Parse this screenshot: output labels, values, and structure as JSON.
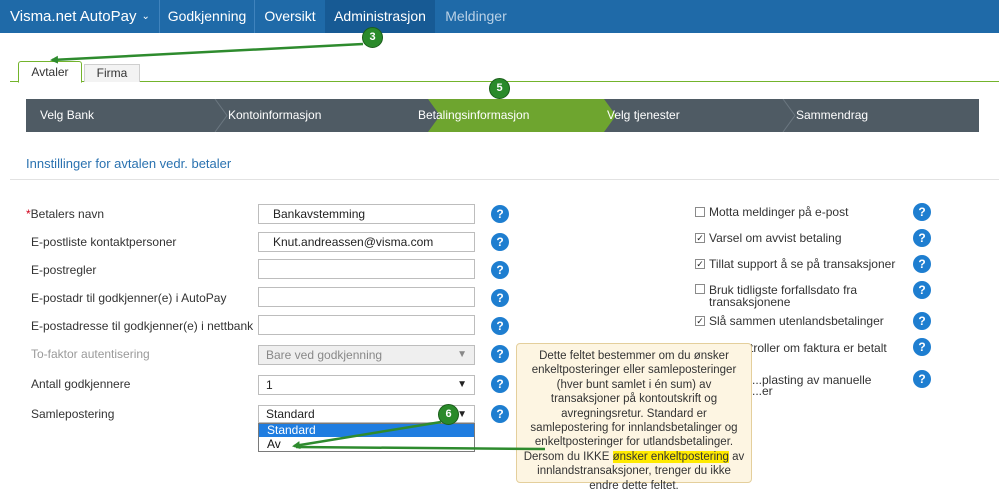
{
  "nav": {
    "brand": "Visma.net AutoPay",
    "items": [
      "Godkjenning",
      "Oversikt",
      "Administrasjon",
      "Meldinger"
    ],
    "active": "Administrasjon"
  },
  "tabs": [
    "Avtaler",
    "Firma"
  ],
  "wizard": {
    "steps": [
      "Velg Bank",
      "Kontoinformasjon",
      "Betalingsinformasjon",
      "Velg tjenester",
      "Sammendrag"
    ],
    "current": "Betalingsinformasjon"
  },
  "section_title": "Innstillinger for avtalen vedr. betaler",
  "form": {
    "betalers_navn_label": "Betalers navn",
    "betalers_navn_required": "*",
    "betalers_navn_value": "Bankavstemming",
    "kontaktpersoner_label": "E-postliste kontaktpersoner",
    "kontaktpersoner_value": "Knut.andreassen@visma.com",
    "epostregler_label": "E-postregler",
    "epostregler_value": "",
    "godkjenner_autopay_label": "E-postadr til godkjenner(e) i AutoPay",
    "godkjenner_autopay_value": "",
    "godkjenner_nettbank_label": "E-postadresse til godkjenner(e) i nettbank",
    "godkjenner_nettbank_value": "",
    "tofaktor_label": "To-faktor autentisering",
    "tofaktor_value": "Bare ved godkjenning",
    "antall_label": "Antall godkjennere",
    "antall_value": "1",
    "samlepostering_label": "Samlepostering",
    "samlepostering_value": "Standard",
    "samlepostering_options": [
      "Standard",
      "Av"
    ]
  },
  "checkboxes": [
    {
      "label": "Motta meldinger på e-post",
      "checked": false
    },
    {
      "label": "Varsel om avvist betaling",
      "checked": true
    },
    {
      "label": "Tillat support å se på transaksjoner",
      "checked": true
    },
    {
      "label": "Bruk tidligste forfallsdato fra transaksjonene",
      "checked": false
    },
    {
      "label": "Slå sammen utenlandsbetalinger",
      "checked": true
    },
    {
      "label": "...troller om faktura er betalt",
      "checked": false
    },
    {
      "label": "...plasting av manuelle",
      "checked": false
    },
    {
      "label": "...er",
      "checked": false
    }
  ],
  "tooltip": {
    "text_before": "Dette feltet bestemmer om du ønsker enkeltposteringer eller samleposteringer (hver bunt samlet i én sum) av transaksjoner på kontoutskrift og avregningsretur. Standard er samlepostering for innlandsbetalinger og enkeltposteringer for utlandsbetalinger. Dersom du IKKE ",
    "highlight": "ønsker enkeltpostering",
    "text_after": " av innlandstransaksjoner, trenger du ikke endre dette feltet."
  },
  "help_glyph": "?",
  "callouts": [
    "3",
    "5",
    "6"
  ],
  "colors": {
    "topnav": "#1f6aa8",
    "wizard": "#4f5b64",
    "wizard_active": "#6ea52f",
    "accent_green": "#73b42c",
    "help_blue": "#1e7ed0",
    "callout_green": "#2a8a2a",
    "tooltip_bg": "#fdf5e2",
    "highlight": "#ffea00"
  }
}
